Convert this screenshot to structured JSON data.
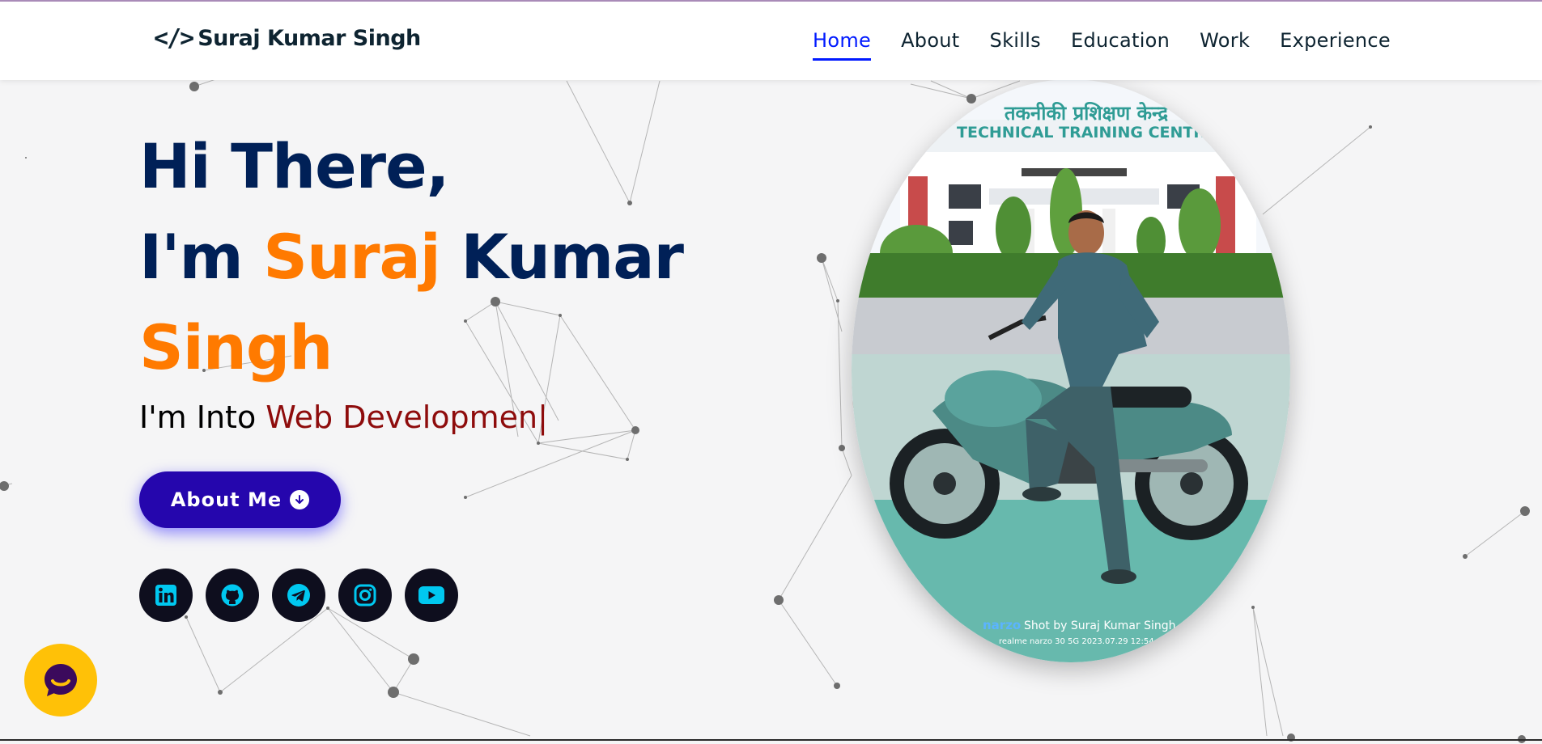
{
  "header": {
    "brand_icon": "</>",
    "brand_name": "Suraj Kumar Singh",
    "nav": [
      {
        "label": "Home",
        "active": true
      },
      {
        "label": "About",
        "active": false
      },
      {
        "label": "Skills",
        "active": false
      },
      {
        "label": "Education",
        "active": false
      },
      {
        "label": "Work",
        "active": false
      },
      {
        "label": "Experience",
        "active": false
      }
    ]
  },
  "hero": {
    "line1": "Hi There,",
    "line2_prefix": "I'm ",
    "line2_highlight": "Suraj",
    "line2_suffix": " Kumar",
    "line3_highlight": "Singh",
    "tagline_prefix": "I'm Into ",
    "tagline_typed": "Web Developmen",
    "tagline_cursor": "|",
    "about_button": "About Me",
    "about_button_icon": "arrow-down-circle-icon"
  },
  "socials": [
    {
      "name": "linkedin-icon"
    },
    {
      "name": "github-icon"
    },
    {
      "name": "telegram-icon"
    },
    {
      "name": "instagram-icon"
    },
    {
      "name": "youtube-icon"
    }
  ],
  "photo": {
    "sign_hindi": "तकनीकी प्रशिक्षण केन्द्र",
    "sign_english": "TECHNICAL TRAINING CENTRE",
    "watermark_brand": "narzo",
    "watermark_credit": "Shot by Suraj Kumar Singh",
    "watermark_meta": "realme narzo 30 5G   2023.07.29 12:54"
  },
  "colors": {
    "navy": "#002057",
    "orange": "#ff7a00",
    "typed_red": "#8e0c0c",
    "nav_active": "#011aff",
    "button": "#2506ad",
    "social_bg": "#0e0e1e",
    "social_icon": "#00c8f0",
    "chat_bg": "#ffc107"
  }
}
